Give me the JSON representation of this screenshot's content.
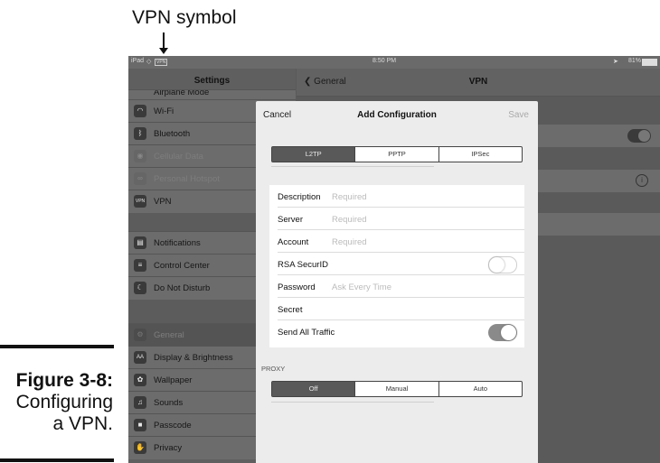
{
  "callout": {
    "label": "VPN symbol"
  },
  "caption": {
    "figure": "Figure 3-8:",
    "line1": "Configuring",
    "line2": "a VPN."
  },
  "status_bar": {
    "device": "iPad",
    "vpn": "VPN",
    "time": "8:50 PM",
    "battery": "81%"
  },
  "sidebar": {
    "title": "Settings",
    "top_partial": "Airplane Mode",
    "items": [
      {
        "label": "Wi-Fi",
        "icon": "◠"
      },
      {
        "label": "Bluetooth",
        "icon": "ᛒ"
      },
      {
        "label": "Cellular Data",
        "icon": "◉"
      },
      {
        "label": "Personal Hotspot",
        "icon": "∞"
      },
      {
        "label": "VPN",
        "icon": "VPN"
      },
      {
        "label": "Notifications",
        "icon": "▤"
      },
      {
        "label": "Control Center",
        "icon": "≡"
      },
      {
        "label": "Do Not Disturb",
        "icon": "☾"
      },
      {
        "label": "General",
        "icon": "⚙"
      },
      {
        "label": "Display & Brightness",
        "icon": "AA"
      },
      {
        "label": "Wallpaper",
        "icon": "✿"
      },
      {
        "label": "Sounds",
        "icon": "♫"
      },
      {
        "label": "Passcode",
        "icon": "■"
      },
      {
        "label": "Privacy",
        "icon": "✋"
      }
    ]
  },
  "detail": {
    "back_label": "General",
    "title": "VPN",
    "info_symbol": "i"
  },
  "modal": {
    "cancel": "Cancel",
    "title": "Add Configuration",
    "save": "Save",
    "type_segments": [
      "L2TP",
      "PPTP",
      "IPSec"
    ],
    "type_selected": "L2TP",
    "fields": [
      {
        "label": "Description",
        "placeholder": "Required"
      },
      {
        "label": "Server",
        "placeholder": "Required"
      },
      {
        "label": "Account",
        "placeholder": "Required"
      },
      {
        "label": "RSA SecurID",
        "toggle": false
      },
      {
        "label": "Password",
        "placeholder": "Ask Every Time"
      },
      {
        "label": "Secret",
        "placeholder": ""
      },
      {
        "label": "Send All Traffic",
        "toggle": true
      }
    ],
    "proxy_label": "PROXY",
    "proxy_segments": [
      "Off",
      "Manual",
      "Auto"
    ],
    "proxy_selected": "Off"
  }
}
